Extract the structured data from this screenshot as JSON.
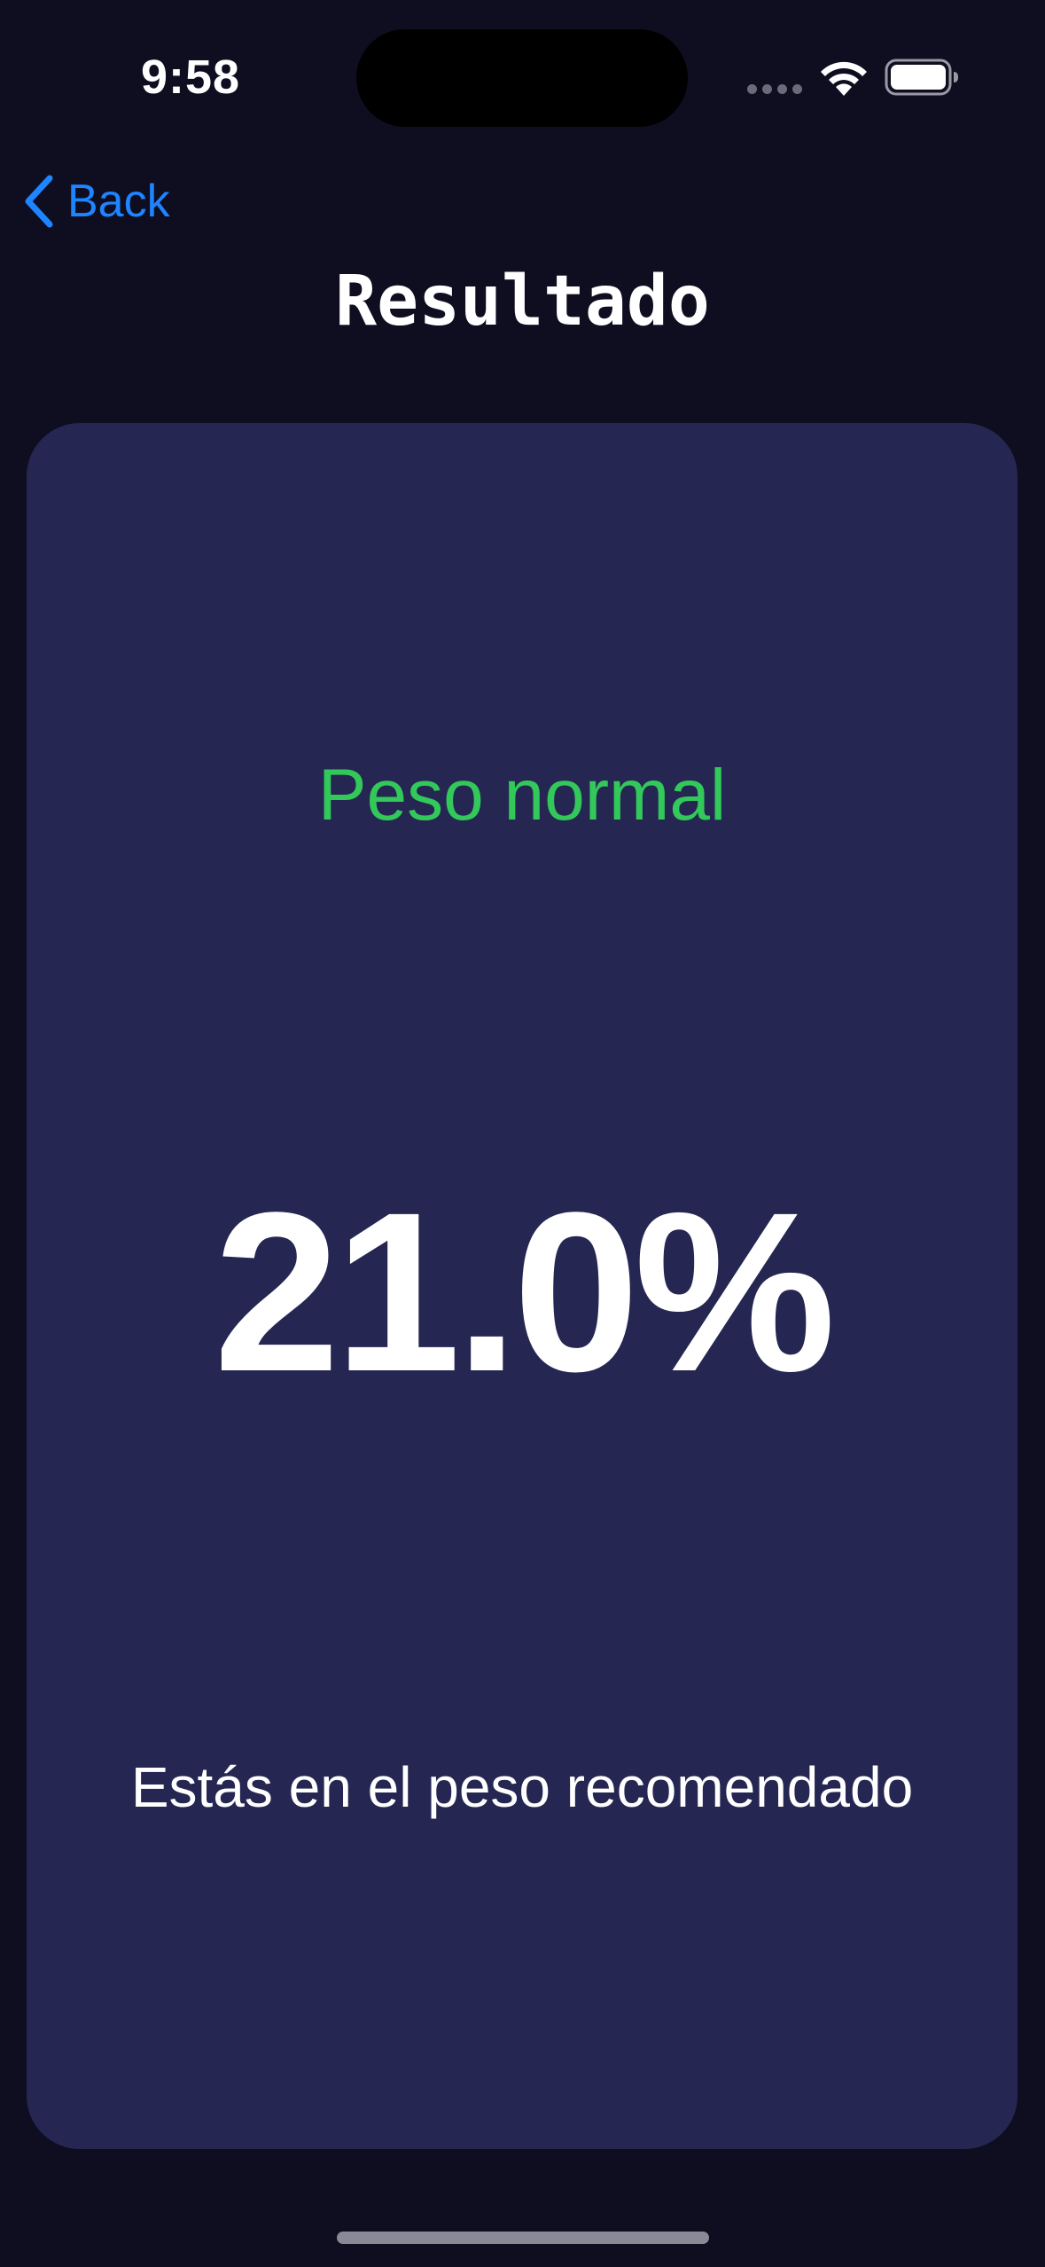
{
  "status_bar": {
    "time": "9:58"
  },
  "nav": {
    "back_label": "Back",
    "title": "Resultado"
  },
  "result": {
    "category": "Peso normal",
    "value": "21.0%",
    "message": "Estás en el peso recomendado"
  },
  "colors": {
    "background": "#0e0e20",
    "card": "#252652",
    "accent": "#1f84ff",
    "category": "#33c85a"
  },
  "icons": {
    "back": "chevron-left-icon",
    "wifi": "wifi-icon",
    "battery": "battery-icon"
  }
}
